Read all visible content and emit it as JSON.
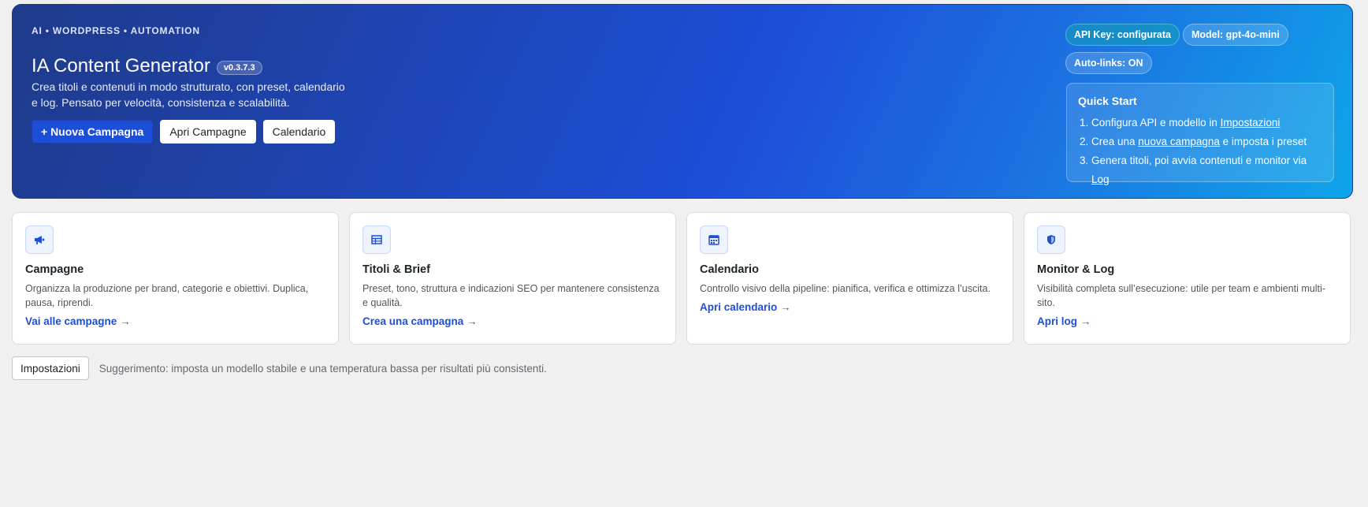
{
  "hero": {
    "eyebrow": "AI • WORDPRESS • AUTOMATION",
    "title": "IA Content Generator",
    "version": "v0.3.7.3",
    "description": "Crea titoli e contenuti in modo strutturato, con preset, calendario e log. Pensato per velocità, consistenza e scalabilità.",
    "buttons": {
      "new_campaign": "+ Nuova Campagna",
      "open_campaigns": "Apri Campagne",
      "calendar": "Calendario"
    },
    "pills": {
      "api_key": "API Key: configurata",
      "model": "Model: gpt-4o-mini",
      "autolinks": "Auto-links: ON"
    },
    "quick_start": {
      "title": "Quick Start",
      "step1_pre": "Configura API e modello in ",
      "step1_link": "Impostazioni",
      "step2_pre": "Crea una ",
      "step2_link": "nuova campagna",
      "step2_post": " e imposta i preset",
      "step3_pre": "Genera titoli, poi avvia contenuti e monitor via ",
      "step3_link": "Log"
    }
  },
  "cards": [
    {
      "title": "Campagne",
      "text": "Organizza la produzione per brand, categorie e obiettivi. Duplica, pausa, riprendi.",
      "link": "Vai alle campagne →",
      "icon": "megaphone-icon"
    },
    {
      "title": "Titoli & Brief",
      "text": "Preset, tono, struttura e indicazioni SEO per mantenere consistenza e qualità.",
      "link": "Crea una campagna →",
      "icon": "table-icon"
    },
    {
      "title": "Calendario",
      "text": "Controllo visivo della pipeline: pianifica, verifica e ottimizza l’uscita.",
      "link": "Apri calendario →",
      "icon": "calendar-icon"
    },
    {
      "title": "Monitor & Log",
      "text": "Visibilità completa sull’esecuzione: utile per team e ambienti multi-sito.",
      "link": "Apri log →",
      "icon": "shield-icon"
    }
  ],
  "footer": {
    "settings_button": "Impostazioni",
    "hint": "Suggerimento: imposta un modello stabile e una temperatura bassa per risultati più consistenti."
  },
  "colors": {
    "accent": "#1d4ed8",
    "hero_start": "#1e3a8a",
    "hero_end": "#0ea5e9"
  }
}
